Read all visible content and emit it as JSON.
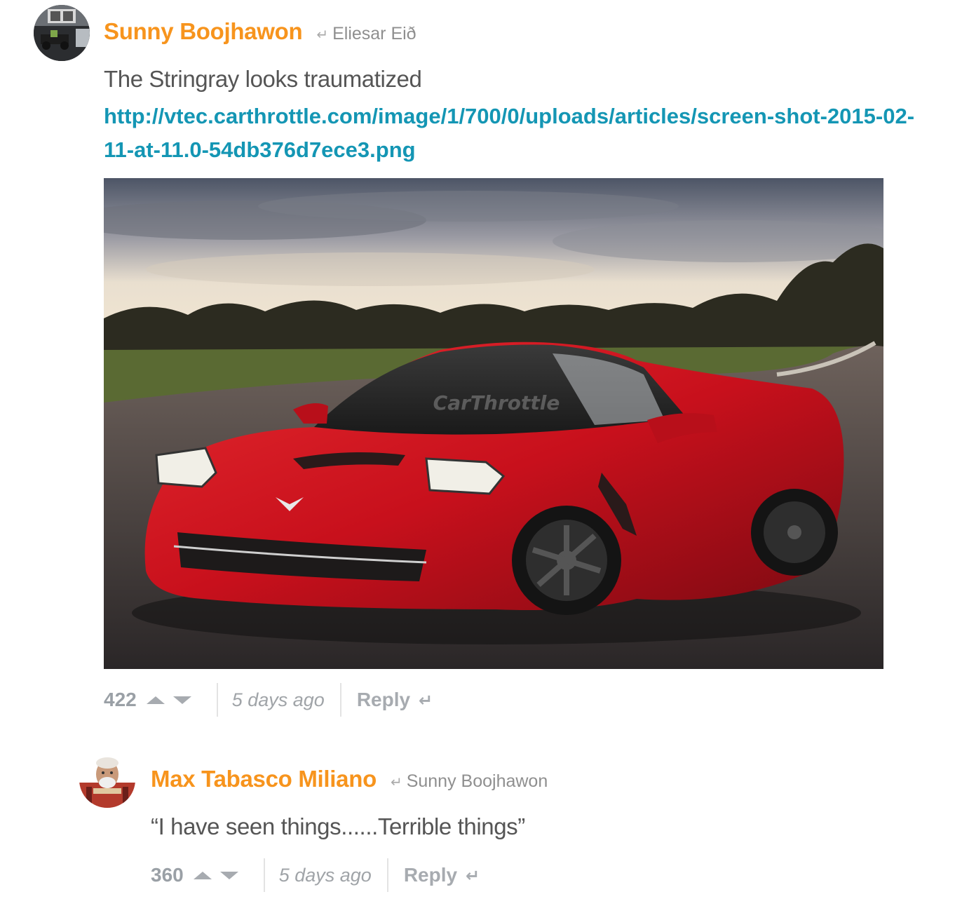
{
  "comments": [
    {
      "author": "Sunny Boojhawon",
      "reply_to": "Eliesar Eið",
      "reply_arrow": "↵",
      "text": "The Stringray looks traumatized",
      "link": "http://vtec.carthrottle.com/image/1/700/0/uploads/articles/screen-shot-2015-02-11-at-11.0-54db376d7ece3.png",
      "image_watermark": "CarThrottle",
      "score": "422",
      "timestamp": "5 days ago",
      "reply_label": "Reply",
      "reply_icon": "↵"
    },
    {
      "author": "Max Tabasco Miliano",
      "reply_to": "Sunny Boojhawon",
      "reply_arrow": "↵",
      "text": "“I have seen things......Terrible things”",
      "score": "360",
      "timestamp": "5 days ago",
      "reply_label": "Reply",
      "reply_icon": "↵"
    }
  ],
  "colors": {
    "author": "#f7941d",
    "link": "#1496b4",
    "muted": "#a7abb0",
    "car": "#c8101c"
  },
  "icons": [
    "upvote-icon",
    "downvote-icon",
    "reply-arrow-icon"
  ]
}
